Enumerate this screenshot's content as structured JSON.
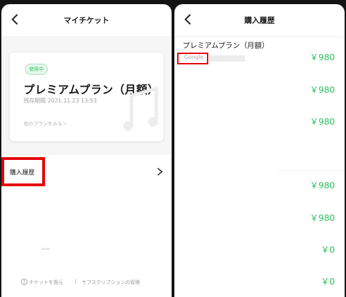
{
  "left_screen": {
    "title": "マイチケット",
    "ticket": {
      "badge": "使用中",
      "plan_name": "プレミアムプラン（月額）",
      "period": "残存期間 2021.11.23 13:53",
      "more_plans": "他のプランをみる＞"
    },
    "history_label": "購入履歴",
    "footer": {
      "restore": "チケットを復元",
      "separator": "|",
      "manage": "サブスクリプションの管理"
    }
  },
  "right_screen": {
    "title": "購入履歴",
    "purchase_title": "プレミアムプラン（月額）",
    "store": "Google",
    "prices": [
      "￥980",
      "￥980",
      "￥980",
      "￥980",
      "￥980",
      "￥0",
      "￥0"
    ]
  },
  "colors": {
    "accent_green": "#2fbf5f",
    "highlight_red": "#e50000"
  }
}
